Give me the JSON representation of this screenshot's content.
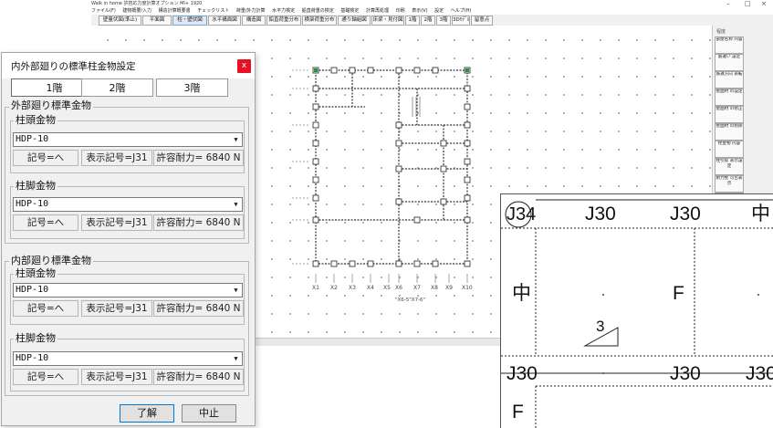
{
  "app": {
    "title": "Walk in home 許容応力度計算オプション MI+ 1920",
    "menu": [
      "ファイル(F)",
      "建物概要/入力",
      "構造計算概要書",
      "チェックリスト",
      "荷重/外力計算",
      "水平力検定",
      "鉛直荷重の検定",
      "基礎検定",
      "計算再処理",
      "印刷",
      "表示(V)",
      "設定",
      "ヘルプ(H)"
    ],
    "toolbar": [
      "壁量伏図(準止)",
      "平面図",
      "柱・壁伏図",
      "水平構面図",
      "構造図",
      "鉛直荷重分布",
      "横架荷重分布",
      "通り軸組図",
      "床梁・見付図",
      "1階",
      "2階",
      "3階",
      "3Dﾓﾃﾞﾙ",
      "留意点"
    ],
    "side_buttons": [
      "部屋名称 内容",
      "筋違い 設定",
      "筋違方向 表転",
      "壁面材 の設定",
      "壁面材 の修正",
      "壁面材 の削除",
      "柱金物 内容",
      "柱引抜 表示設定",
      "耐力壁 可否表示",
      "壁耐力 表示",
      "柱金物 表示"
    ],
    "side_top_label": "程度"
  },
  "dialog": {
    "title": "内外部廻りの標準柱金物設定",
    "close": "x",
    "tabs": [
      "1階",
      "2階",
      "3階"
    ],
    "active_tab": "1階",
    "outer": {
      "title": "外部廻り標準金物",
      "head": {
        "label": "柱頭金物",
        "value": "HDP-10",
        "symbol": "記号=へ",
        "display": "表示記号=J31",
        "capacity": "許容耐力= 6840 N"
      },
      "foot": {
        "label": "柱脚金物",
        "value": "HDP-10",
        "symbol": "記号=へ",
        "display": "表示記号=J31",
        "capacity": "許容耐力= 6840 N"
      }
    },
    "inner": {
      "title": "内部廻り標準金物",
      "head": {
        "label": "柱頭金物",
        "value": "HDP-10",
        "symbol": "記号=へ",
        "display": "表示記号=J31",
        "capacity": "許容耐力= 6840 N"
      },
      "foot": {
        "label": "柱脚金物",
        "value": "HDP-10",
        "symbol": "記号=へ",
        "display": "表示記号=J31",
        "capacity": "許容耐力= 6840 N"
      }
    },
    "ok": "了解",
    "cancel": "中止"
  },
  "plan": {
    "axis_labels": [
      "X1",
      "X2",
      "X3",
      "X4",
      "X5",
      "X6",
      "X7",
      "X8",
      "X9",
      "X10"
    ],
    "dimension_note": "\"X6-5\"X7-6\""
  },
  "zoom": {
    "labels": [
      "J34",
      "J30",
      "J30",
      "中",
      "中",
      "F",
      "3",
      "J30",
      "J30",
      "J30",
      "F"
    ]
  },
  "colors": {
    "close_red": "#e81123",
    "canvas_bg": "#ffffff",
    "dialog_bg": "#f0f0f0",
    "post_green": "#1a9a3a"
  }
}
